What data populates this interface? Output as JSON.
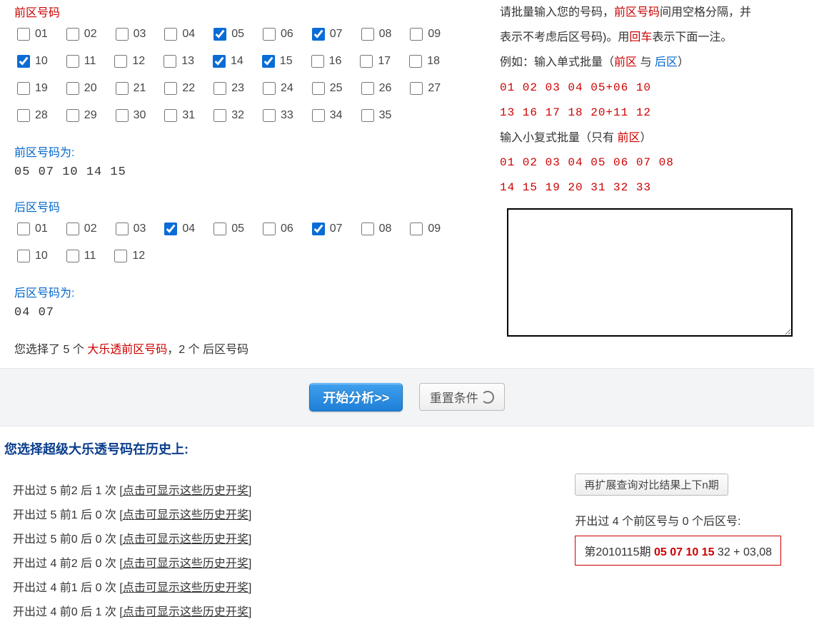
{
  "front": {
    "title": "前区号码",
    "numbers": [
      "01",
      "02",
      "03",
      "04",
      "05",
      "06",
      "07",
      "08",
      "09",
      "10",
      "11",
      "12",
      "13",
      "14",
      "15",
      "16",
      "17",
      "18",
      "19",
      "20",
      "21",
      "22",
      "23",
      "24",
      "25",
      "26",
      "27",
      "28",
      "29",
      "30",
      "31",
      "32",
      "33",
      "34",
      "35"
    ],
    "checked": [
      "05",
      "07",
      "10",
      "14",
      "15"
    ],
    "picked_label": "前区号码为:",
    "picked_display": "05 07 10 14 15"
  },
  "back": {
    "title": "后区号码",
    "numbers": [
      "01",
      "02",
      "03",
      "04",
      "05",
      "06",
      "07",
      "08",
      "09",
      "10",
      "11",
      "12"
    ],
    "checked": [
      "04",
      "07"
    ],
    "picked_label": "后区号码为:",
    "picked_display": "04 07"
  },
  "summary": {
    "prefix": "您选择了 ",
    "front_count": "5",
    "mid": " 个 ",
    "red_text": "大乐透前区号码",
    "comma": "，",
    "back_count": "2",
    "mid2": " 个 ",
    "back_text": "后区号码"
  },
  "instructions": {
    "line1a": "请批量输入您的号码，",
    "line1b": "前区号码",
    "line1c": "间用空格分隔，并",
    "line2a": "表示不考虑后区号码)。用",
    "line2b_red": "回车",
    "line2c": "表示下面一注。",
    "line3a": "例如：输入单式批量（",
    "line3_front": "前区",
    "line3_with": " 与 ",
    "line3_back": "后区",
    "line3_close": "）",
    "ex1": "01 02 03 04 05+06 10",
    "ex2": "13 16 17 18 20+11 12",
    "line4a": "输入小复式批量（只有 ",
    "line4_front": "前区",
    "line4_close": "）",
    "ex3": "01 02 03 04 05 06 07 08",
    "ex4": "14 15 19 20 31 32 33"
  },
  "buttons": {
    "analyze": "开始分析>>",
    "reset": "重置条件"
  },
  "results": {
    "title": "您选择超级大乐透号码在历史上:",
    "link_text": "[点击可显示这些历史开奖]",
    "rows": [
      "开出过 5 前2 后 1 次",
      "开出过 5 前1 后 0 次",
      "开出过 5 前0 后 0 次",
      "开出过 4 前2 后 0 次",
      "开出过 4 前1 后 0 次",
      "开出过 4 前0 后 1 次"
    ],
    "expand_btn": "再扩展查询对比结果上下n期",
    "match_heading": "开出过 4 个前区号与 0 个后区号:",
    "match_issue_prefix": "第",
    "match_issue": "2010115",
    "match_issue_suffix": "期",
    "match_hits": "05 07 10 15",
    "match_rest": " 32 + 03,08"
  }
}
